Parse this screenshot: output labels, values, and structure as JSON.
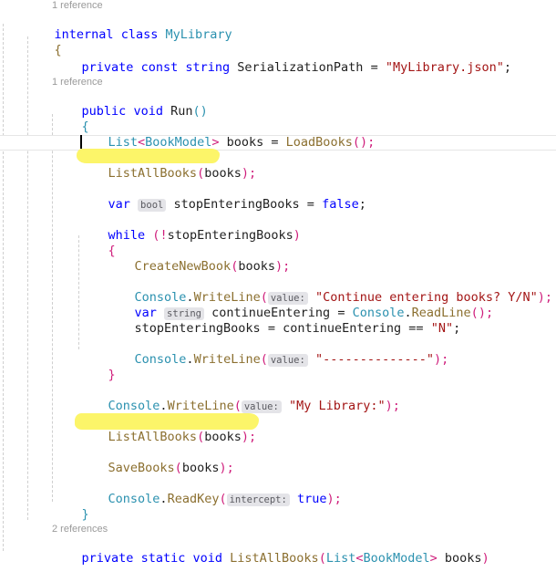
{
  "editor": {
    "language": "csharp",
    "colors": {
      "background": "#ffffff",
      "keyword": "#0000ff",
      "type": "#2b91af",
      "string": "#a31515",
      "punctuation": "#cf1d7b",
      "method": "#8b6f2f",
      "plain": "#1f1f1f",
      "codelens": "#9a9a9a",
      "highlight_marker": "#fcf569",
      "indent_guide": "#cfcfcf",
      "current_line_border": "#e6e6e6",
      "hint_background": "#e4e4e8",
      "hint_text": "#5a5a60",
      "caret": "#000000"
    },
    "codelens": {
      "class_myLibrary": "1 reference",
      "method_run": "1 reference",
      "method_listAllBooks": "2 references"
    },
    "lines": {
      "l01": "internal class MyLibrary",
      "l02": "{",
      "l03": "    private const string SerializationPath = \"MyLibrary.json\";",
      "l04": "    public void Run()",
      "l05": "    {",
      "l06": "        List<BookModel> books = LoadBooks();",
      "l07": "        ListAllBooks(books);",
      "l08": "        var bool stopEnteringBooks = false;",
      "l09": "        while (!stopEnteringBooks)",
      "l10": "        {",
      "l11": "            CreateNewBook(books);",
      "l12": "            Console.WriteLine(value: \"Continue entering books? Y/N\");",
      "l13": "            var string continueEntering = Console.ReadLine();",
      "l14": "            stopEnteringBooks = continueEntering == \"N\";",
      "l15": "            Console.WriteLine(value: \"--------------\");",
      "l16": "        }",
      "l17": "        Console.WriteLine(value: \"My Library:\");",
      "l18": "        ListAllBooks(books);",
      "l19": "        SaveBooks(books);",
      "l20": "        Console.ReadKey(intercept: true);",
      "l21": "    }",
      "l22": "    private static void ListAllBooks(List<BookModel> books)"
    },
    "tokens": {
      "kw_internal": "internal",
      "kw_class": "class",
      "name_myLibrary": "MyLibrary",
      "brace_open": "{",
      "brace_close": "}",
      "kw_private": "private",
      "kw_const": "const",
      "kw_string": "string",
      "name_serializationPath": "SerializationPath",
      "op_assign": "=",
      "str_myLibraryJson": "\"MyLibrary.json\"",
      "semi": ";",
      "kw_public": "public",
      "kw_void": "void",
      "name_run": "Run",
      "paren_open": "(",
      "paren_close": ")",
      "type_list": "List",
      "angle_open": "<",
      "type_bookModel": "BookModel",
      "angle_close": ">",
      "name_books": "books",
      "meth_loadBooks": "LoadBooks",
      "meth_listAllBooks": "ListAllBooks",
      "kw_var": "var",
      "hint_bool": "bool",
      "name_stopEnteringBooks": "stopEnteringBooks",
      "kw_false": "false",
      "kw_while": "while",
      "op_not": "!",
      "meth_createNewBook": "CreateNewBook",
      "type_console": "Console",
      "dot": ".",
      "meth_writeLine": "WriteLine",
      "hint_value": "value:",
      "str_continue": "\"Continue entering books? Y/N\"",
      "hint_string": "string",
      "name_continueEntering": "continueEntering",
      "meth_readLine": "ReadLine",
      "op_equals": "==",
      "str_n": "\"N\"",
      "str_dashes": "\"--------------\"",
      "str_myLibraryLabel": "\"My Library:\"",
      "meth_saveBooks": "SaveBooks",
      "meth_readKey": "ReadKey",
      "hint_intercept": "intercept:",
      "kw_true": "true",
      "kw_static": "static"
    }
  }
}
